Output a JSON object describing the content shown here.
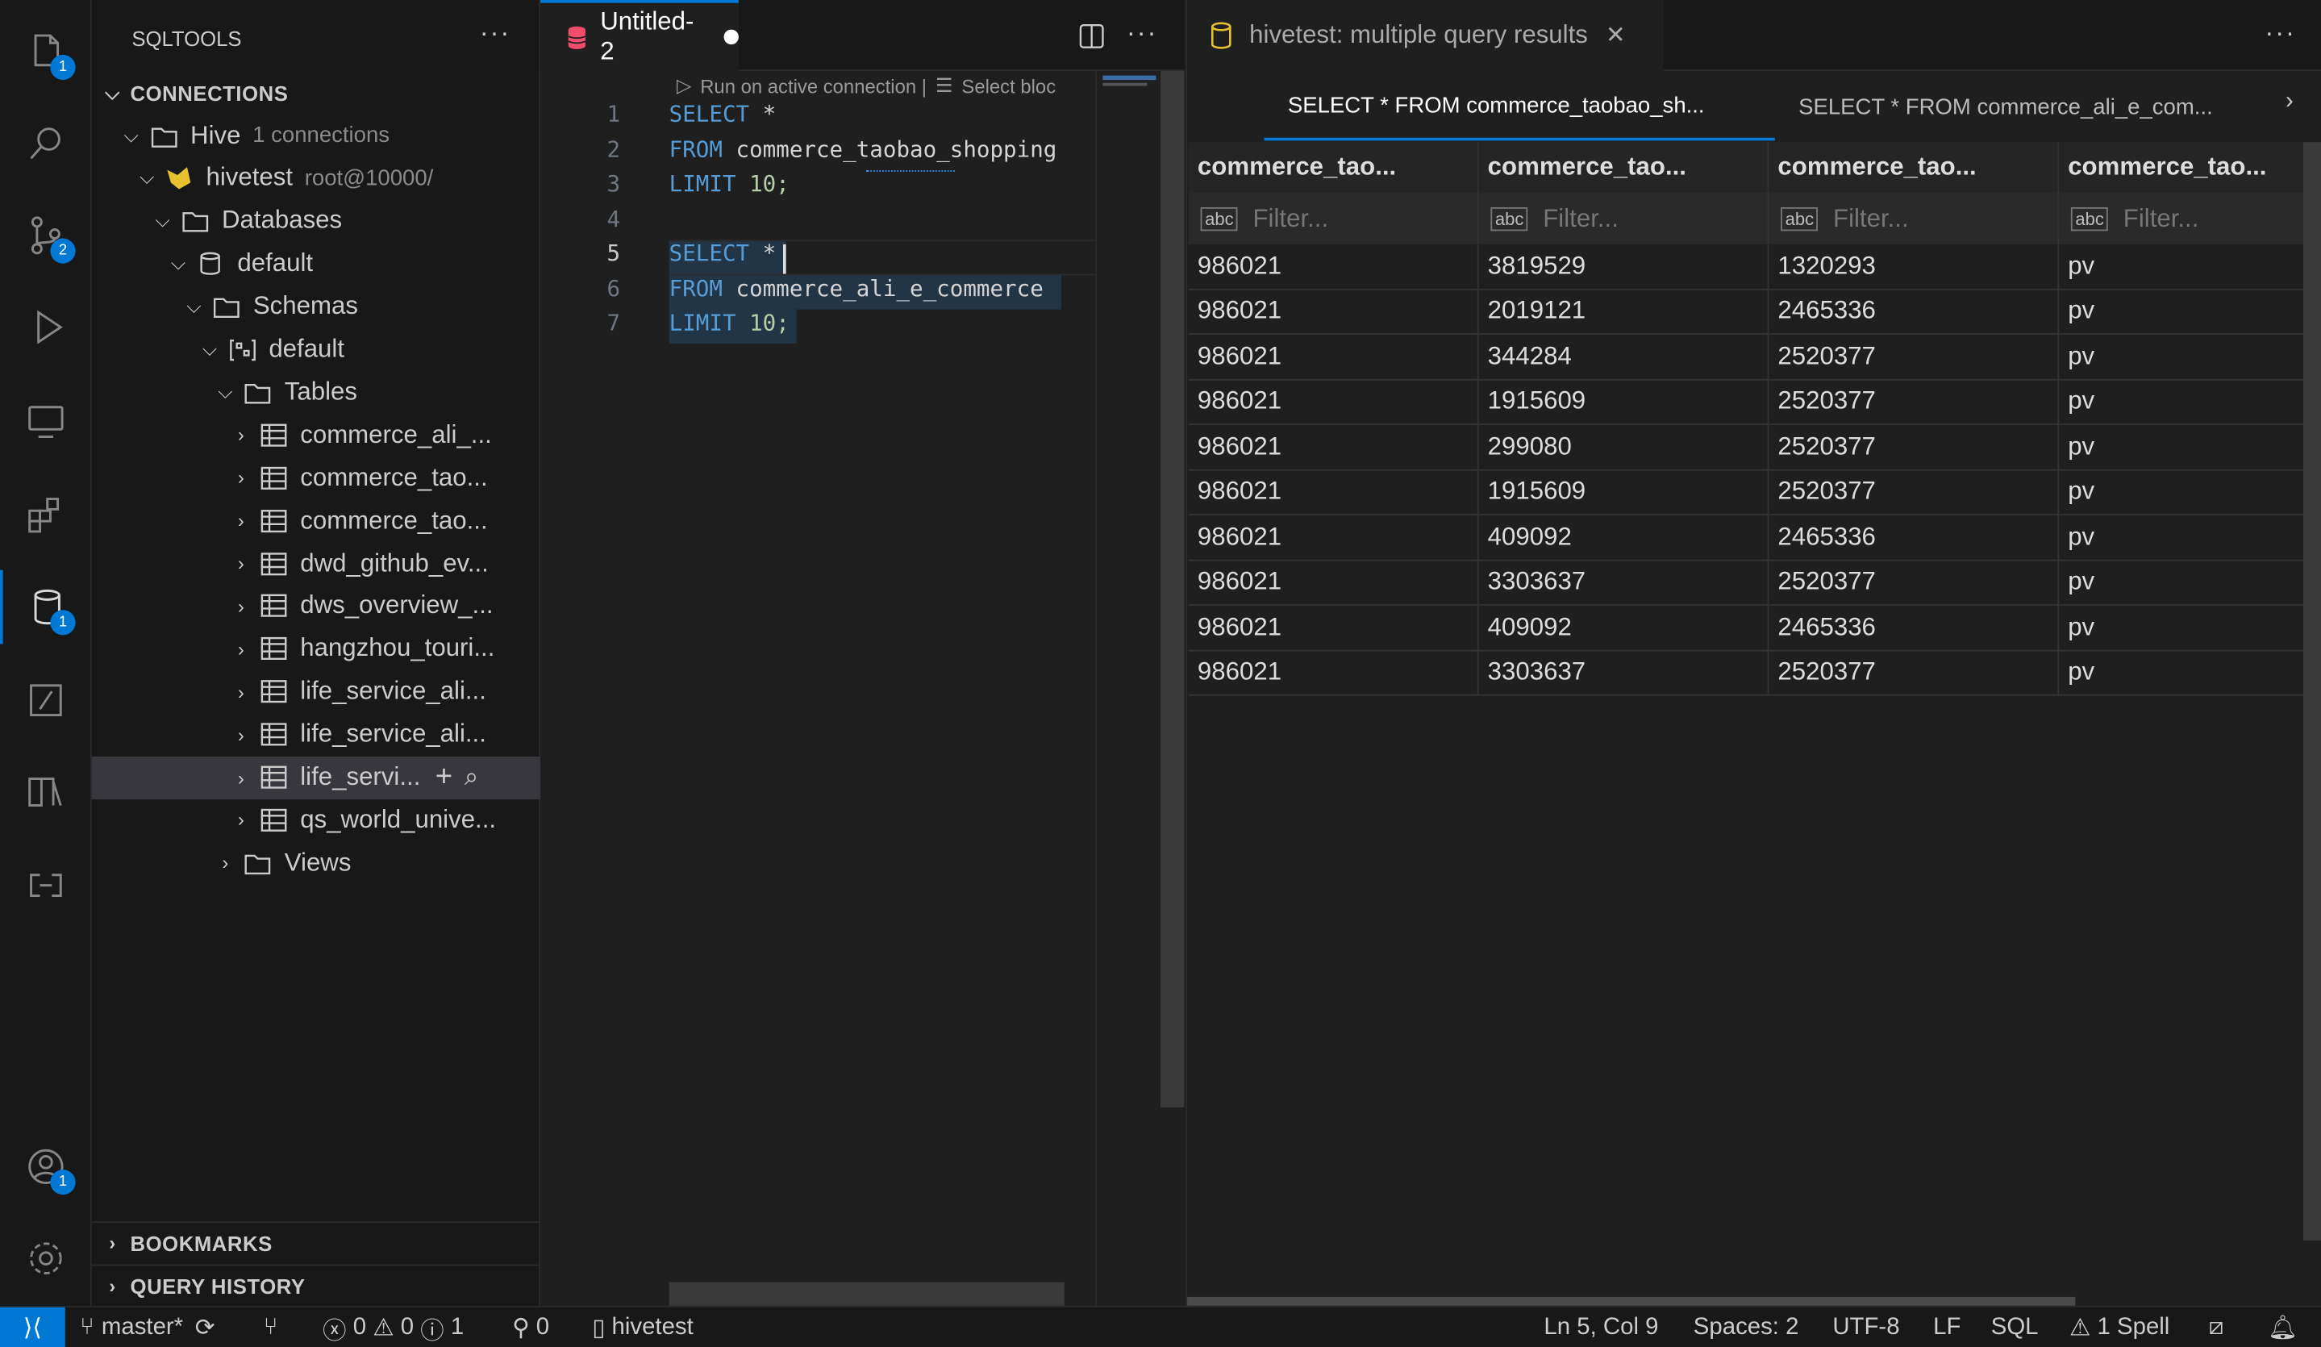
{
  "activity": [
    {
      "icon": "files-icon",
      "badge": "1"
    },
    {
      "icon": "search-icon"
    },
    {
      "icon": "source-control-icon",
      "badge": "2"
    },
    {
      "icon": "run-debug-icon"
    },
    {
      "icon": "remote-explorer-icon"
    },
    {
      "icon": "extensions-icon"
    },
    {
      "icon": "database-icon",
      "badge": "1",
      "active": true
    },
    {
      "icon": "sql-notebook-icon"
    },
    {
      "icon": "library-icon"
    },
    {
      "icon": "remote-icon"
    }
  ],
  "accounts_badge": "1",
  "sidebar": {
    "title": "SQLTOOLS",
    "connections_label": "CONNECTIONS",
    "bookmarks_label": "BOOKMARKS",
    "query_history_label": "QUERY HISTORY",
    "tree": [
      {
        "label": "Hive",
        "sub": "1 connections",
        "icon": "folder-icon",
        "level": 1,
        "open": true
      },
      {
        "label": "hivetest",
        "sub": "root@10000/",
        "icon": "hive-icon",
        "level": 2,
        "open": true
      },
      {
        "label": "Databases",
        "icon": "folder-icon",
        "level": 3,
        "open": true
      },
      {
        "label": "default",
        "icon": "database-icon",
        "level": 4,
        "open": true
      },
      {
        "label": "Schemas",
        "icon": "folder-icon",
        "level": 5,
        "open": true
      },
      {
        "label": "default",
        "icon": "schema-icon",
        "level": 6,
        "open": true
      },
      {
        "label": "Tables",
        "icon": "folder-icon",
        "level": 7,
        "open": true
      },
      {
        "label": "commerce_ali_...",
        "icon": "table-icon",
        "level": 8
      },
      {
        "label": "commerce_tao...",
        "icon": "table-icon",
        "level": 8
      },
      {
        "label": "commerce_tao...",
        "icon": "table-icon",
        "level": 8
      },
      {
        "label": "dwd_github_ev...",
        "icon": "table-icon",
        "level": 8
      },
      {
        "label": "dws_overview_...",
        "icon": "table-icon",
        "level": 8
      },
      {
        "label": "hangzhou_touri...",
        "icon": "table-icon",
        "level": 8
      },
      {
        "label": "life_service_ali...",
        "icon": "table-icon",
        "level": 8
      },
      {
        "label": "life_service_ali...",
        "icon": "table-icon",
        "level": 8
      },
      {
        "label": "life_servi...",
        "icon": "table-icon",
        "level": 8,
        "selected": true
      },
      {
        "label": "qs_world_unive...",
        "icon": "table-icon",
        "level": 8
      },
      {
        "label": "Views",
        "icon": "folder-icon",
        "level": 7
      }
    ]
  },
  "editor": {
    "tab_label": "Untitled-2",
    "codelens": "Run on active connection |",
    "codelens2": "Select bloc",
    "lines": [
      [
        "SELECT",
        " *"
      ],
      [
        "FROM",
        " commerce_taobao_shopping"
      ],
      [
        "LIMIT",
        " 10;"
      ],
      [
        "",
        ""
      ],
      [
        "SELECT",
        " *"
      ],
      [
        "FROM",
        " commerce_ali_e_commerce"
      ],
      [
        "LIMIT",
        " 10;"
      ]
    ]
  },
  "results": {
    "panel_title": "hivetest: multiple query results",
    "tabs": [
      "SELECT * FROM commerce_taobao_sh...",
      "SELECT * FROM commerce_ali_e_com..."
    ],
    "columns": [
      "commerce_tao...",
      "commerce_tao...",
      "commerce_tao...",
      "commerce_tao..."
    ],
    "filter_placeholder": "Filter...",
    "rows": [
      [
        "986021",
        "3819529",
        "1320293",
        "pv"
      ],
      [
        "986021",
        "2019121",
        "2465336",
        "pv"
      ],
      [
        "986021",
        "344284",
        "2520377",
        "pv"
      ],
      [
        "986021",
        "1915609",
        "2520377",
        "pv"
      ],
      [
        "986021",
        "299080",
        "2520377",
        "pv"
      ],
      [
        "986021",
        "1915609",
        "2520377",
        "pv"
      ],
      [
        "986021",
        "409092",
        "2465336",
        "pv"
      ],
      [
        "986021",
        "3303637",
        "2520377",
        "pv"
      ],
      [
        "986021",
        "409092",
        "2465336",
        "pv"
      ],
      [
        "986021",
        "3303637",
        "2520377",
        "pv"
      ]
    ]
  },
  "status": {
    "branch": "master*",
    "errors": "0",
    "warnings": "0",
    "info": "1",
    "ports": "0",
    "connection": "hivetest",
    "position": "Ln 5, Col 9",
    "spaces": "Spaces: 2",
    "encoding": "UTF-8",
    "eol": "LF",
    "language": "SQL",
    "spell": "1 Spell"
  },
  "colors": {
    "accent": "#0078d4",
    "db_tab_icon": "#f14c6c",
    "hive_icon": "#e8c22e"
  }
}
